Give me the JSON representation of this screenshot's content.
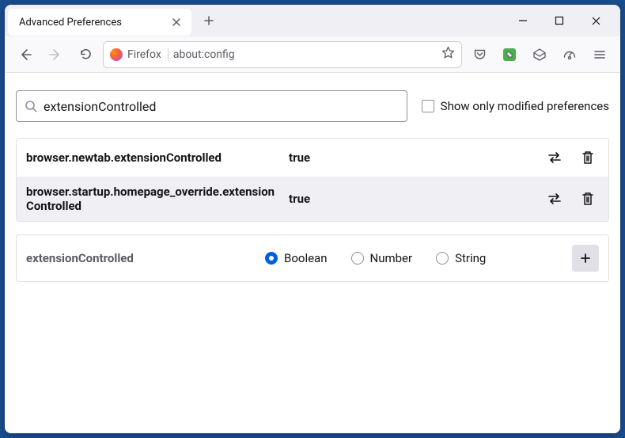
{
  "tab": {
    "title": "Advanced Preferences"
  },
  "url": {
    "identity": "Firefox",
    "address": "about:config"
  },
  "search": {
    "value": "extensionControlled"
  },
  "checkbox": {
    "label": "Show only modified preferences",
    "checked": false
  },
  "prefs": [
    {
      "name": "browser.newtab.extensionControlled",
      "value": "true"
    },
    {
      "name": "browser.startup.homepage_override.extensionControlled",
      "value": "true"
    }
  ],
  "newPref": {
    "name": "extensionControlled",
    "types": [
      {
        "label": "Boolean",
        "checked": true
      },
      {
        "label": "Number",
        "checked": false
      },
      {
        "label": "String",
        "checked": false
      }
    ]
  }
}
